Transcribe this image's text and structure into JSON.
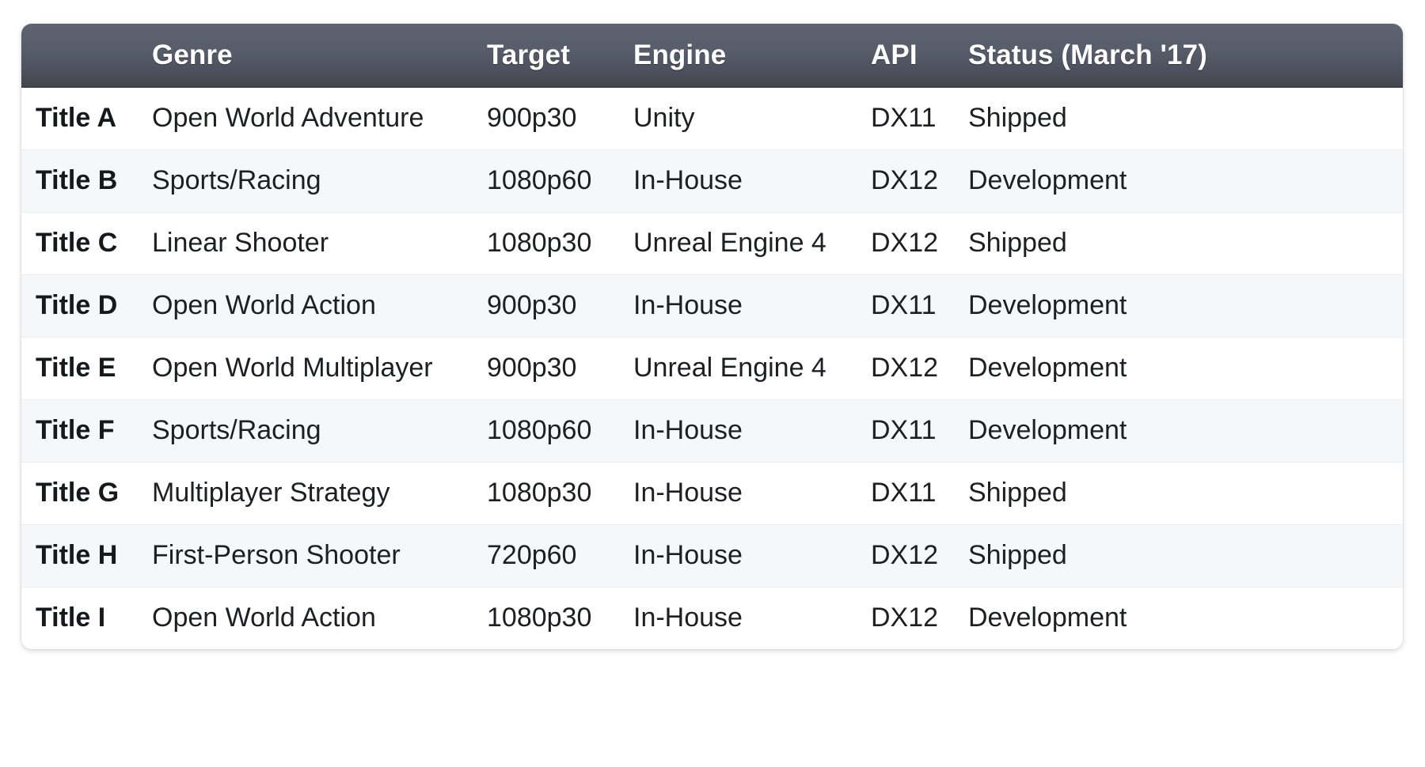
{
  "table": {
    "columns": [
      {
        "key": "title",
        "label": ""
      },
      {
        "key": "genre",
        "label": "Genre"
      },
      {
        "key": "target",
        "label": "Target"
      },
      {
        "key": "engine",
        "label": "Engine"
      },
      {
        "key": "api",
        "label": "API"
      },
      {
        "key": "status",
        "label": "Status (March '17)"
      }
    ],
    "rows": [
      {
        "title": "Title A",
        "genre": "Open World Adventure",
        "target": "900p30",
        "engine": "Unity",
        "api": "DX11",
        "status": "Shipped"
      },
      {
        "title": "Title B",
        "genre": "Sports/Racing",
        "target": "1080p60",
        "engine": "In-House",
        "api": "DX12",
        "status": "Development"
      },
      {
        "title": "Title C",
        "genre": "Linear Shooter",
        "target": "1080p30",
        "engine": "Unreal Engine 4",
        "api": "DX12",
        "status": "Shipped"
      },
      {
        "title": "Title D",
        "genre": "Open World Action",
        "target": "900p30",
        "engine": "In-House",
        "api": "DX11",
        "status": "Development"
      },
      {
        "title": "Title E",
        "genre": "Open World Multiplayer",
        "target": "900p30",
        "engine": "Unreal Engine 4",
        "api": "DX12",
        "status": "Development"
      },
      {
        "title": "Title F",
        "genre": "Sports/Racing",
        "target": "1080p60",
        "engine": "In-House",
        "api": "DX11",
        "status": "Development"
      },
      {
        "title": "Title G",
        "genre": "Multiplayer Strategy",
        "target": "1080p30",
        "engine": "In-House",
        "api": "DX11",
        "status": "Shipped"
      },
      {
        "title": "Title H",
        "genre": "First-Person Shooter",
        "target": "720p60",
        "engine": "In-House",
        "api": "DX12",
        "status": "Shipped"
      },
      {
        "title": "Title I",
        "genre": "Open World Action",
        "target": "1080p30",
        "engine": "In-House",
        "api": "DX12",
        "status": "Development"
      }
    ]
  },
  "colors": {
    "header_gradient_top": "#5e6372",
    "header_gradient_bottom": "#44474f",
    "header_text": "#ffffff",
    "row_even_bg": "#ffffff",
    "row_odd_bg": "#f6f7f9",
    "body_text": "#1d1f22",
    "row_divider": "#edeef0",
    "card_bg": "#ffffff"
  }
}
